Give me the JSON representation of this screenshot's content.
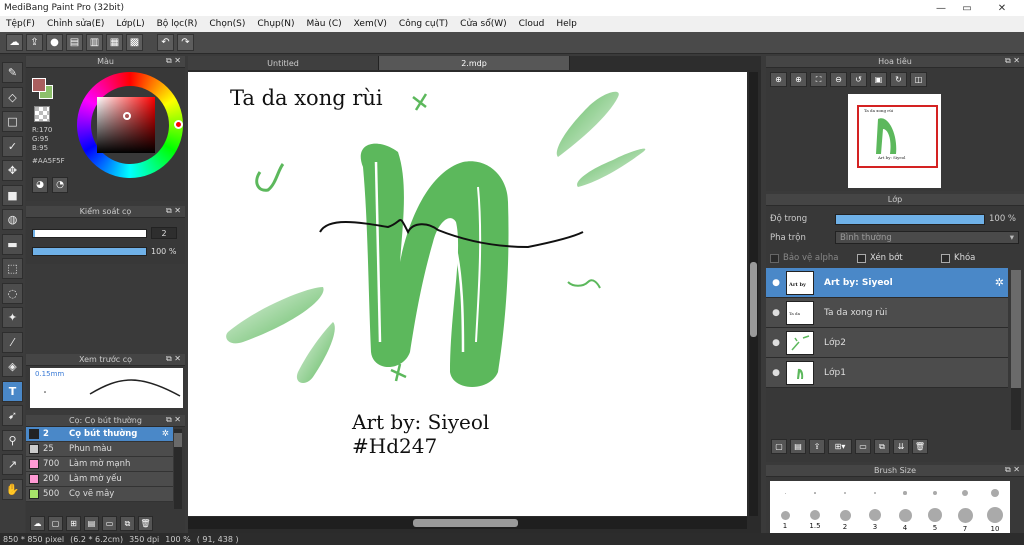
{
  "window": {
    "title": "MediBang Paint Pro (32bit)"
  },
  "menu": [
    "Tệp(F)",
    "Chỉnh sửa(E)",
    "Lớp(L)",
    "Bộ lọc(R)",
    "Chọn(S)",
    "Chụp(N)",
    "Màu (C)",
    "Xem(V)",
    "Công cụ(T)",
    "Cửa sổ(W)",
    "Cloud",
    "Help"
  ],
  "toolbar_icons": [
    "cloud-icon",
    "export-icon",
    "chat-icon",
    "comment-icon",
    "page-icon",
    "pages-icon",
    "grid-icon",
    "undo-icon",
    "redo-icon"
  ],
  "tools": [
    "brush",
    "eraser",
    "rect-select",
    "pen",
    "move",
    "fill-rect",
    "bucket",
    "gradient",
    "lasso-rect",
    "lasso",
    "magic-wand",
    "select-pen",
    "select-eraser",
    "text",
    "operation",
    "eyedropper",
    "eyedropper2",
    "hand"
  ],
  "color_panel": {
    "title": "Màu",
    "r": "R:170",
    "g": "G:95",
    "b": "B:95",
    "hex": "#AA5F5F",
    "main_color": "#AA5F5F"
  },
  "brush_control": {
    "title": "Kiểm soát cọ",
    "size_value": "2",
    "size_fraction": 0.02,
    "opacity_value": "100 %",
    "opacity_fraction": 1.0
  },
  "brush_preview": {
    "title": "Xem trước cọ",
    "size_label": "0.15mm"
  },
  "brush_list": {
    "title": "Cọ: Cọ bút thường",
    "items": [
      {
        "size": "2",
        "name": "Cọ bút thường",
        "color": "#222222",
        "selected": true
      },
      {
        "size": "25",
        "name": "Phun màu",
        "color": "#cccccc",
        "selected": false
      },
      {
        "size": "700",
        "name": "Làm mờ mạnh",
        "color": "#ff9ad5",
        "selected": false
      },
      {
        "size": "200",
        "name": "Làm mờ yếu",
        "color": "#ff9ad5",
        "selected": false
      },
      {
        "size": "500",
        "name": "Cọ vẽ mây",
        "color": "#a7e36a",
        "selected": false
      }
    ]
  },
  "tabs": [
    {
      "label": "Untitled",
      "active": false
    },
    {
      "label": "2.mdp",
      "active": true
    }
  ],
  "canvas": {
    "text_top": "Ta da xong rùi",
    "text_bottom_line1": "Art by: Siyeol",
    "text_bottom_line2": "#Hd247",
    "accent_green": "#5cb85c"
  },
  "navigator": {
    "title": "Hoa tiêu"
  },
  "layer_panel": {
    "title": "Lớp",
    "opacity_label": "Độ trong",
    "opacity_value": "100 %",
    "blend_label": "Pha trộn",
    "blend_value": "Bình thường",
    "protect_alpha": "Bảo vệ alpha",
    "clipping": "Xén bớt",
    "lock": "Khóa",
    "layers": [
      {
        "name": "Art by: Siyeol",
        "selected": true,
        "gear": true
      },
      {
        "name": "Ta da xong rùi",
        "selected": false
      },
      {
        "name": "Lớp2",
        "selected": false
      },
      {
        "name": "Lớp1",
        "selected": false
      }
    ]
  },
  "brush_size_panel": {
    "title": "Brush Size",
    "sizes": [
      "",
      "",
      "",
      "",
      "",
      "",
      "",
      "",
      "1",
      "1.5",
      "2",
      "3",
      "4",
      "5",
      "7",
      "10"
    ]
  },
  "status": {
    "size": "850 * 850 pixel",
    "cm": "(6.2 * 6.2cm)",
    "dpi": "350 dpi",
    "zoom": "100 %",
    "coords": "( 91, 438 )"
  }
}
